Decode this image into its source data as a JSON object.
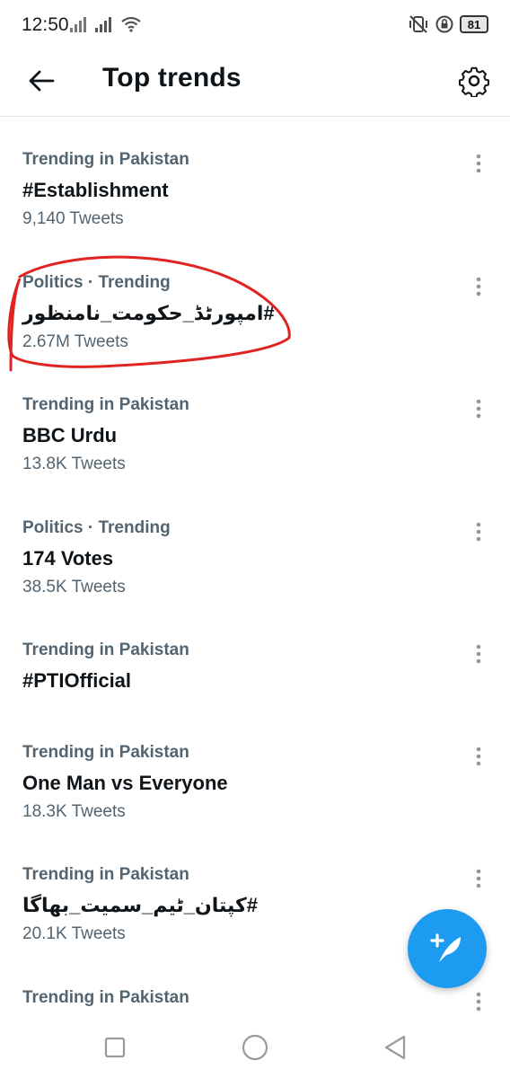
{
  "status_bar": {
    "time": "12:50",
    "battery": "81",
    "icons": [
      "signal-icon",
      "signal-icon",
      "wifi-icon",
      "vibrate-off-icon",
      "lock-rotation-icon",
      "battery-icon"
    ]
  },
  "header": {
    "title": "Top trends",
    "back_icon": "arrow-left-icon",
    "settings_icon": "gear-icon"
  },
  "trends": [
    {
      "meta": "Trending in Pakistan",
      "name": "#Establishment",
      "count": "9,140 Tweets"
    },
    {
      "meta": "Politics · Trending",
      "name": "#امپورٹڈ_حکومت_نامنظور",
      "count": "2.67M Tweets"
    },
    {
      "meta": "Trending in Pakistan",
      "name": "BBC Urdu",
      "count": "13.8K Tweets"
    },
    {
      "meta": "Politics · Trending",
      "name": "174 Votes",
      "count": "38.5K Tweets"
    },
    {
      "meta": "Trending in Pakistan",
      "name": "#PTIOfficial",
      "count": ""
    },
    {
      "meta": "Trending in Pakistan",
      "name": "One Man vs Everyone",
      "count": "18.3K Tweets"
    },
    {
      "meta": "Trending in Pakistan",
      "name": "#کپتان_ٹیم_سمیت_بھاگا",
      "count": "20.1K Tweets"
    },
    {
      "meta": "Trending in Pakistan",
      "name": "",
      "count": ""
    }
  ],
  "fab": {
    "icon": "compose-tweet-icon"
  },
  "colors": {
    "accent": "#1d9bf0",
    "secondary_text": "#536471",
    "primary_text": "#0f1419",
    "annotation": "#e02424"
  },
  "nav_bar": {
    "icons": [
      "recents-icon",
      "home-icon",
      "back-icon"
    ]
  }
}
